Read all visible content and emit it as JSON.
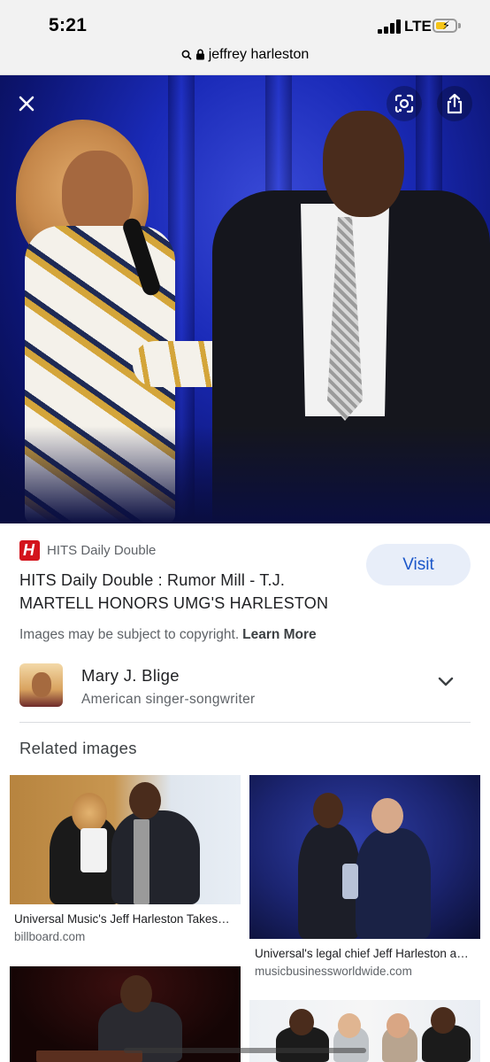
{
  "status_bar": {
    "time": "5:21",
    "network": "LTE"
  },
  "url_bar": {
    "query": "jeffrey harleston"
  },
  "result": {
    "source_name": "HITS Daily Double",
    "source_logo_letter": "H",
    "title": "HITS Daily Double : Rumor Mill - T.J. MARTELL HONORS UMG'S HARLESTON",
    "visit_label": "Visit",
    "copyright_text": "Images may be subject to copyright.",
    "learn_more_label": "Learn More"
  },
  "entity": {
    "name": "Mary J. Blige",
    "description": "American singer-songwriter"
  },
  "related": {
    "heading": "Related images",
    "items": [
      {
        "caption": "Universal Music's Jeff Harleston Takes…",
        "domain": "billboard.com"
      },
      {
        "caption": "Universal's legal chief Jeff Harleston a…",
        "domain": "musicbusinessworldwide.com"
      }
    ]
  },
  "icons": {
    "close": "close-icon",
    "lens": "lens-icon",
    "share": "share-icon",
    "lock": "lock-icon",
    "search": "search-icon",
    "chevron": "chevron-down-icon"
  },
  "colors": {
    "visit_text": "#1a56c9",
    "visit_bg": "#e8eef9",
    "source_logo": "#d3141c",
    "battery_fill": "#f5c518"
  }
}
